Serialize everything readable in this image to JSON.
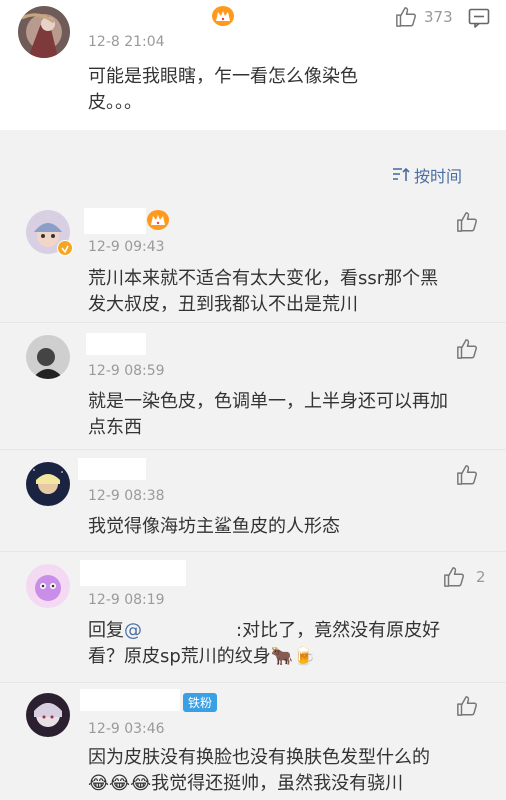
{
  "main_comment": {
    "timestamp": "12-8 21:04",
    "like_count": "373",
    "text": "可能是我眼瞎，乍一看怎么像染色\n皮。。。"
  },
  "sort": {
    "label": "按时间"
  },
  "replies": [
    {
      "timestamp": "12-9 09:43",
      "text": "荒川本来就不适合有太大变化，看ssr那个黑\n发大叔皮，丑到我都认不出是荒川"
    },
    {
      "timestamp": "12-9 08:59",
      "text": "就是一染色皮，色调单一，上半身还可以再加\n点东西"
    },
    {
      "timestamp": "12-9 08:38",
      "text": "我觉得像海坊主鲨鱼皮的人形态"
    },
    {
      "timestamp": "12-9 08:19",
      "like_count": "2",
      "reply_prefix": "回复",
      "mention_symbol": "@",
      "text_after_mention": ":对比了，竟然没有原皮好",
      "text_line2": "看？原皮sp荒川的纹身",
      "emoji": "🐂🍺"
    },
    {
      "timestamp": "12-9 03:46",
      "badge": "铁粉",
      "text_line1": "因为皮肤没有换脸也没有换肤色发型什么的",
      "emoji_prefix": "😂😂😂",
      "text_line2": "我觉得还挺帅，虽然我没有骁川"
    }
  ],
  "colors": {
    "accent_blue": "#4a6fa5",
    "vip_orange": "#ff9a1f",
    "text_gray": "#9a9a9a",
    "background": "#f2f2f2"
  },
  "icons": {
    "like": "thumbs-up-icon",
    "comment": "comment-icon",
    "sort": "sort-icon",
    "vip": "crown-icon"
  }
}
